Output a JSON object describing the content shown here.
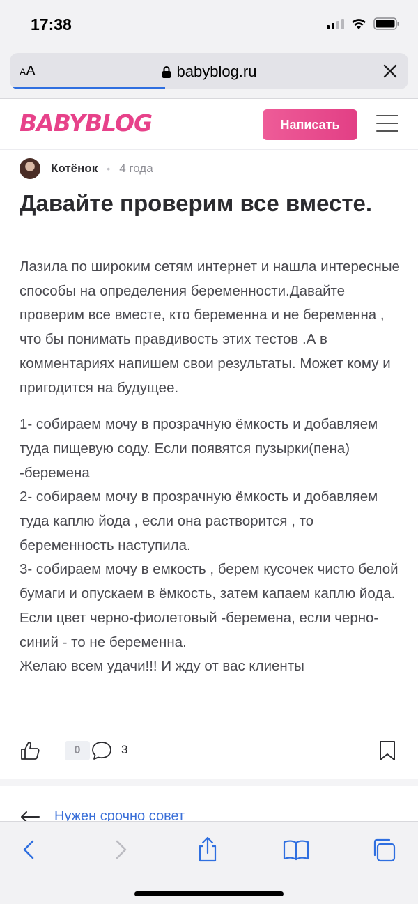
{
  "status_bar": {
    "time": "17:38"
  },
  "browser": {
    "text_size_label": "AA",
    "url": "babyblog.ru",
    "load_progress": 0.39
  },
  "header": {
    "logo_text": "BABYBLOG",
    "write_button": "Написать"
  },
  "post": {
    "author": "Котёнок",
    "separator": "•",
    "time_ago": "4 года",
    "title": "Давайте проверим все вместе.",
    "paragraphs": [
      "Лазила по широким сетям интернет и нашла интересные способы на определения беременности.Давайте проверим все вместе, кто беременна и не беременна , что бы понимать правдивость этих тестов .А в комментариях напишем свои результаты. Может кому и пригодится на будущее.",
      "1- собираем мочу в прозрачную ёмкость и добавляем туда пищевую соду. Если появятся пузырки(пена) -беремена\n2- собираем мочу в прозрачную ёмкость и добавляем туда каплю йода , если она растворится , то беременность наступила.\n3- собираем мочу в емкость , берем кусочек чисто белой бумаги и опускаем в ёмкость, затем капаем каплю йода. Если цвет черно-фиолетовый -беремена, если черно-синий - то не беременна.\nЖелаю всем удачи!!! И жду от вас клиенты"
    ],
    "likes": "0",
    "comments": "3"
  },
  "next_post": {
    "label": "Нужен срочно совет"
  },
  "colors": {
    "brand": "#e7428a",
    "link": "#3a6fd8",
    "accent_ios": "#2f6fe0"
  },
  "icons": [
    "signal-icon",
    "wifi-icon",
    "battery-icon",
    "lock-icon",
    "close-icon",
    "menu-icon",
    "like-icon",
    "comment-icon",
    "bookmark-icon",
    "back-arrow-icon",
    "back-icon",
    "forward-icon",
    "share-icon",
    "bookmarks-icon",
    "tabs-icon"
  ]
}
